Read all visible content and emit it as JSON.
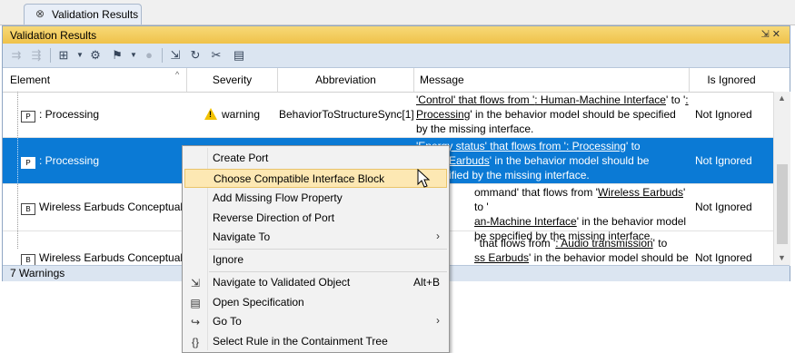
{
  "tab": {
    "close_glyph": "⊗",
    "title": "Validation Results"
  },
  "panel": {
    "title": "Validation Results",
    "title_buttons": "⇲ ✕",
    "status": "7 Warnings"
  },
  "columns": [
    "Element",
    "Severity",
    "Abbreviation",
    "Message",
    "Is Ignored"
  ],
  "rows": [
    {
      "element": ": Processing",
      "element_icon": "P",
      "severity": "warning",
      "abbreviation": "BehaviorToStructureSync[1]",
      "message_parts": [
        "'Control' that flows from '",
        ": Human-Machine Interface",
        "' to '",
        ": Processing",
        "' in the behavior model should be specified by the missing interface."
      ],
      "ignored": "Not Ignored"
    },
    {
      "element": ": Processing",
      "element_icon": "P",
      "severity": "",
      "abbreviation": "",
      "message_visible": [
        "'Energy status' that flows from '",
        ": Processing",
        "' to",
        "' in the behavior model should be",
        "ified by the missing interface."
      ],
      "message_link_2": "Earbuds",
      "ignored": "Not Ignored"
    },
    {
      "element": "Wireless Earbuds Conceptual.",
      "element_icon": "B",
      "severity": "",
      "abbreviation": "",
      "message_visible": [
        "ommand' that flows from '",
        "Wireless Earbuds",
        "' to '",
        "an-Machine Interface",
        "' in the behavior model",
        "be specified by the missing interface."
      ],
      "ignored": "Not Ignored"
    },
    {
      "element": "Wireless Earbuds Conceptual.",
      "element_icon": "B",
      "severity": "",
      "abbreviation": "",
      "message_visible": [
        "' that flows from '",
        ": Audio transmission",
        "' to",
        "ss Earbuds",
        "' in the behavior model should be"
      ],
      "ignored": "Not Ignored"
    }
  ],
  "context_menu": {
    "items": [
      {
        "label": "Create Port",
        "icon": "",
        "shortcut": "",
        "submenu": false
      },
      {
        "label": "Choose Compatible Interface Block",
        "icon": "",
        "shortcut": "",
        "submenu": false,
        "highlighted": true
      },
      {
        "label": "Add Missing Flow Property",
        "icon": "",
        "shortcut": "",
        "submenu": false
      },
      {
        "label": "Reverse Direction of Port",
        "icon": "",
        "shortcut": "",
        "submenu": false
      },
      {
        "label": "Navigate To",
        "icon": "",
        "shortcut": "",
        "submenu": true
      },
      {
        "label": "Ignore",
        "icon": "",
        "shortcut": "",
        "submenu": false
      },
      {
        "label": "Navigate to Validated Object",
        "icon": "navigate-icon",
        "shortcut": "Alt+B",
        "submenu": false
      },
      {
        "label": "Open Specification",
        "icon": "specification-icon",
        "shortcut": "",
        "submenu": false
      },
      {
        "label": "Go To",
        "icon": "goto-icon",
        "shortcut": "",
        "submenu": true
      },
      {
        "label": "Select Rule in the Containment Tree",
        "icon": "braces-icon",
        "shortcut": "",
        "submenu": false
      }
    ],
    "submenu_arrow": "›"
  },
  "colors": {
    "selection": "#0b7ad5",
    "title_bar": "#efc24a",
    "toolbar": "#dbe5f1",
    "menu_highlight": "#fde8b3"
  }
}
